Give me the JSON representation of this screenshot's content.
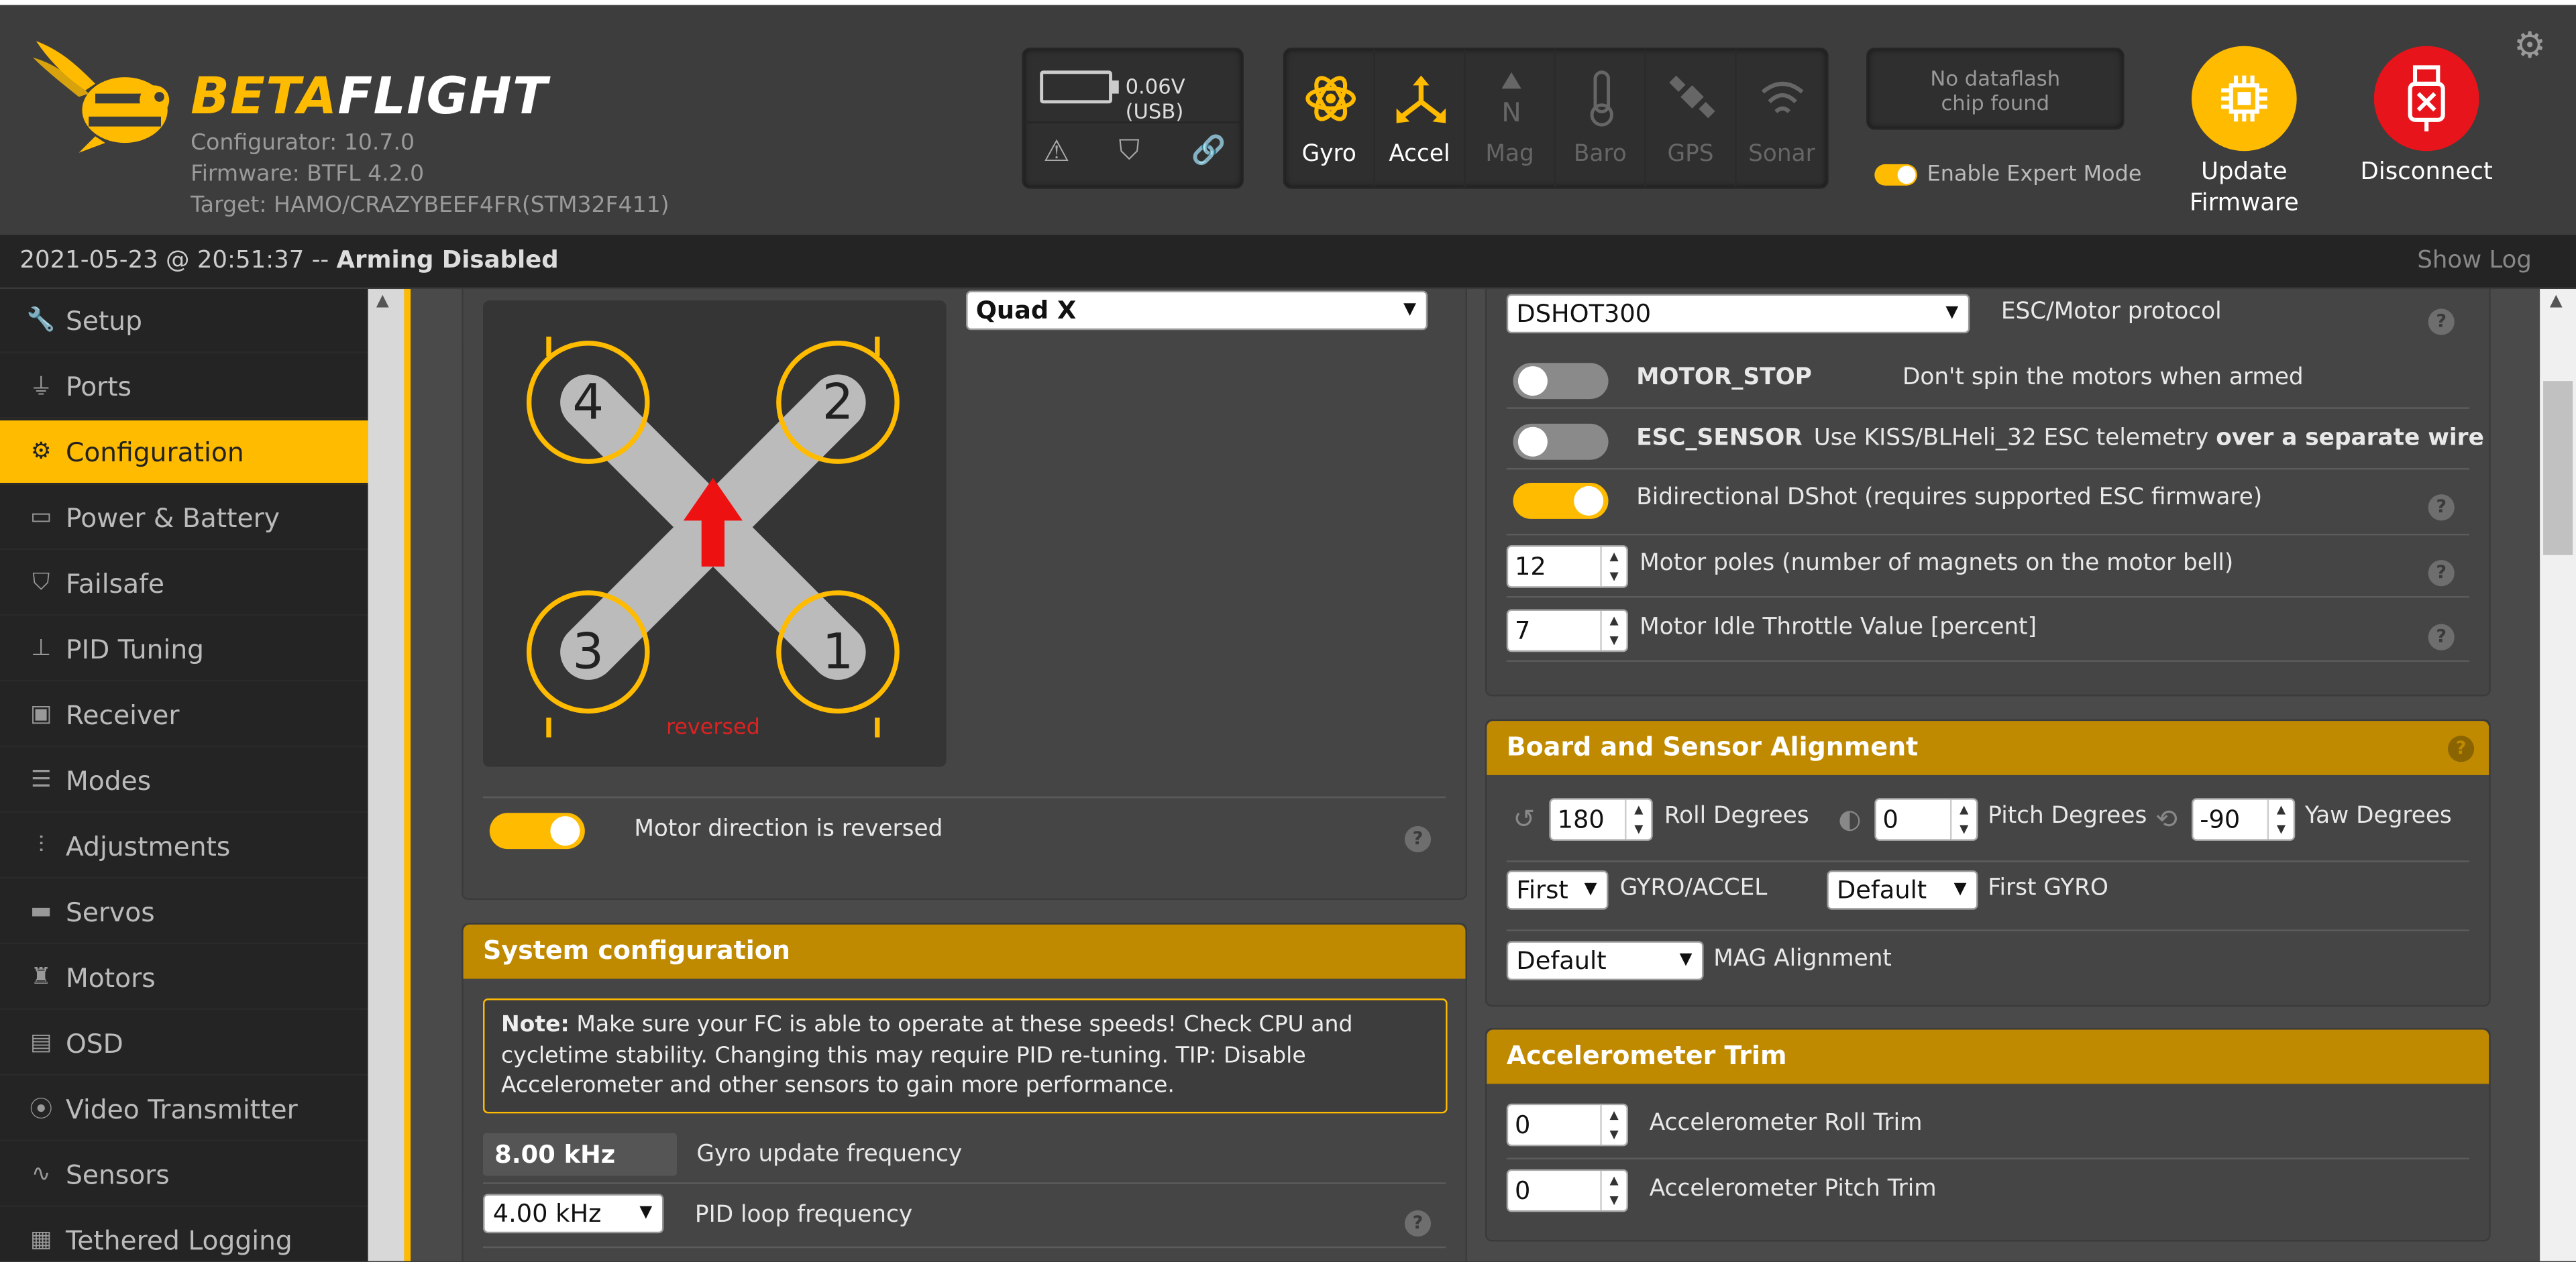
{
  "header": {
    "logo_word1": "BETA",
    "logo_word2": "FLIGHT",
    "configurator": "Configurator: 10.7.0",
    "firmware": "Firmware: BTFL 4.2.0",
    "target": "Target: HAMO/CRAZYBEEF4FR(STM32F411)",
    "battery": "0.06V (USB)",
    "sensors": [
      {
        "label": "Gyro",
        "icon": "gyro-icon",
        "active": true
      },
      {
        "label": "Accel",
        "icon": "accel-icon",
        "active": true
      },
      {
        "label": "Mag",
        "icon": "mag-icon",
        "active": false
      },
      {
        "label": "Baro",
        "icon": "baro-icon",
        "active": false
      },
      {
        "label": "GPS",
        "icon": "gps-icon",
        "active": false
      },
      {
        "label": "Sonar",
        "icon": "sonar-icon",
        "active": false
      }
    ],
    "dataflash_line1": "No dataflash",
    "dataflash_line2": "chip found",
    "expert_mode": "Enable Expert Mode",
    "update_line1": "Update",
    "update_line2": "Firmware",
    "disconnect": "Disconnect",
    "accent": "#ffbb00",
    "disconnect_color": "#e8141b"
  },
  "status": {
    "timestamp": "2021-05-23 @ 20:51:37 -- ",
    "arming": "Arming Disabled",
    "show_log": "Show Log"
  },
  "sidebar": {
    "items": [
      {
        "label": "Setup",
        "icon": "wrench-icon"
      },
      {
        "label": "Ports",
        "icon": "plug-icon"
      },
      {
        "label": "Configuration",
        "icon": "gear-icon",
        "active": true
      },
      {
        "label": "Power & Battery",
        "icon": "battery-icon"
      },
      {
        "label": "Failsafe",
        "icon": "parachute-icon"
      },
      {
        "label": "PID Tuning",
        "icon": "sitemap-icon"
      },
      {
        "label": "Receiver",
        "icon": "receiver-icon"
      },
      {
        "label": "Modes",
        "icon": "toggles-icon"
      },
      {
        "label": "Adjustments",
        "icon": "sliders-icon"
      },
      {
        "label": "Servos",
        "icon": "servo-icon"
      },
      {
        "label": "Motors",
        "icon": "motor-icon"
      },
      {
        "label": "OSD",
        "icon": "osd-icon"
      },
      {
        "label": "Video Transmitter",
        "icon": "antenna-icon"
      },
      {
        "label": "Sensors",
        "icon": "pulse-icon"
      },
      {
        "label": "Tethered Logging",
        "icon": "log-icon"
      }
    ]
  },
  "mixer": {
    "frame": "Quad X",
    "motors": [
      "4",
      "2",
      "3",
      "1"
    ],
    "reversed_label": "reversed",
    "motor_direction": "Motor direction is reversed"
  },
  "system": {
    "title": "System configuration",
    "note_bold": "Note:",
    "note_text": " Make sure your FC is able to operate at these speeds! Check CPU and cycletime stability. Changing this may require PID re-tuning. TIP: Disable Accelerometer and other sensors to gain more performance.",
    "gyro_freq": "8.00 kHz",
    "gyro_freq_label": "Gyro update frequency",
    "pid_freq": "4.00 kHz",
    "pid_freq_label": "PID loop frequency"
  },
  "esc": {
    "protocol": "DSHOT300",
    "protocol_label": "ESC/Motor protocol",
    "motor_stop": "MOTOR_STOP",
    "motor_stop_desc": "Don't spin the motors when armed",
    "esc_sensor": "ESC_SENSOR",
    "esc_sensor_desc1": "Use KISS/BLHeli_32 ESC telemetry ",
    "esc_sensor_desc2": "over a separate wire",
    "bidir": "Bidirectional DShot (requires supported ESC firmware)",
    "poles": "12",
    "poles_label": "Motor poles (number of magnets on the motor bell)",
    "idle": "7",
    "idle_label": "Motor Idle Throttle Value [percent]"
  },
  "alignment": {
    "title": "Board and Sensor Alignment",
    "roll": "180",
    "roll_label": "Roll Degrees",
    "pitch": "0",
    "pitch_label": "Pitch Degrees",
    "yaw": "-90",
    "yaw_label": "Yaw Degrees",
    "gyro_accel": "First",
    "gyro_accel_label": "GYRO/ACCEL",
    "first_gyro": "Default",
    "first_gyro_label": "First GYRO",
    "mag": "Default",
    "mag_label": "MAG Alignment"
  },
  "acc_trim": {
    "title": "Accelerometer Trim",
    "roll": "0",
    "roll_label": "Accelerometer Roll Trim",
    "pitch": "0",
    "pitch_label": "Accelerometer Pitch Trim"
  },
  "help_glyph": "?"
}
